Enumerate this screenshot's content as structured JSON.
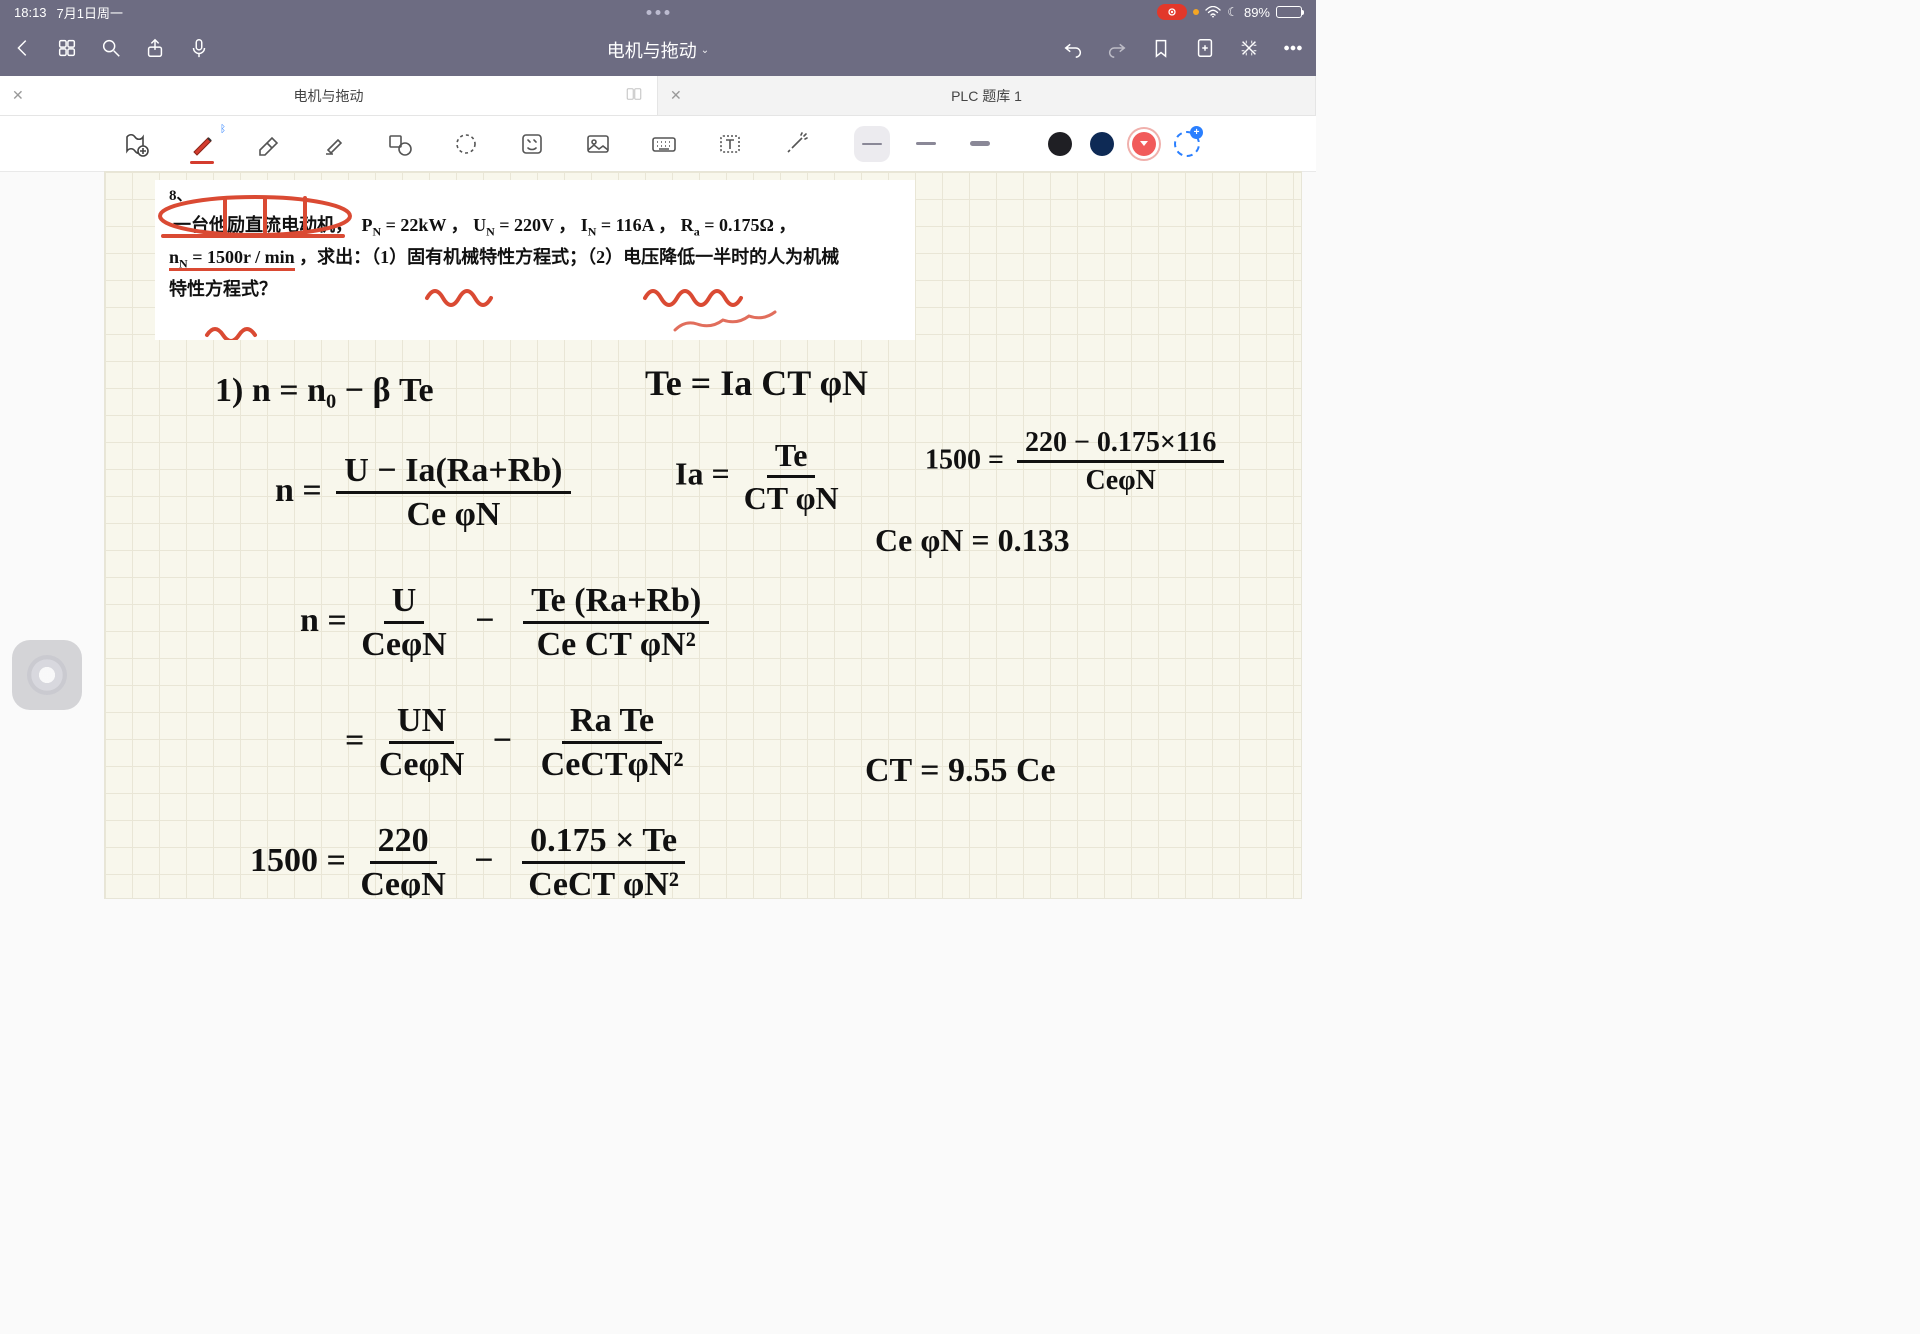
{
  "status": {
    "time": "18:13",
    "date": "7月1日周一",
    "battery_pct": "89%",
    "recording": true,
    "do_not_disturb": true
  },
  "appbar": {
    "title": "电机与拖动",
    "back_label": "返回",
    "undo_label": "撤销",
    "redo_label": "重做",
    "bookmark_label": "书签",
    "add_page_label": "新建页面",
    "close_label": "关闭",
    "more_label": "更多"
  },
  "tabs": [
    {
      "label": "电机与拖动",
      "active": true
    },
    {
      "label": "PLC 题库 1",
      "active": false
    }
  ],
  "tools": {
    "insert_image": "插入图片",
    "pen": "笔",
    "eraser": "橡皮擦",
    "highlighter": "荧光笔",
    "shape": "形状",
    "lasso": "套索",
    "sticker": "贴纸",
    "photo": "图片",
    "keyboard": "键盘",
    "text": "文本",
    "laser": "激光笔",
    "stroke_widths": [
      "细",
      "中",
      "粗"
    ],
    "selected_width": 0,
    "colors": [
      "#1f1f24",
      "#0e2a55",
      "#f15b5b"
    ],
    "selected_color": 2
  },
  "problem": {
    "index": "8、",
    "lead": "一台他励直流电动机，",
    "params": "P<sub>N</sub> = 22kW ，  U<sub>N</sub> = 220V ，  I<sub>N</sub> = 116A ，  R<sub>a</sub> = 0.175Ω ，",
    "line2a": "n<sub>N</sub> = 1500r / min",
    "line2b": "，求出：（1）固有机械特性方程式；（2）电压降低一半时的人为机械",
    "line3": "特性方程式？"
  },
  "handwriting": {
    "l1a": "1)   n  =   n₀  −  β Te",
    "l1b": "Te =  Ia CT φN",
    "l2_lhs": "n  =",
    "l2_num": "U − Ia(Ra+Rb)",
    "l2_den": "Ce φN",
    "l2b_lhs": "Ia  =",
    "l2b_num": "Te",
    "l2b_den": "CT φN",
    "l2c_lhs": "1500 =",
    "l2c_num": "220 − 0.175×116",
    "l2c_den": "CeφN",
    "l2d": "Ce φN =  0.133",
    "l3_lhs": "n =",
    "l3a_num": "U",
    "l3a_den": "CeφN",
    "l3b_num": "Te (Ra+Rb)",
    "l3b_den": "Ce CT φN²",
    "l4_lhs": "  =",
    "l4a_num": "UN",
    "l4a_den": "CeφN",
    "l4b_num": "Ra Te",
    "l4b_den": "CeCTφN²",
    "l4c": "CT = 9.55 Ce",
    "l5_lhs": "1500 =",
    "l5a_num": "220",
    "l5a_den": "CeφN",
    "l5b_num": "0.175 × Te",
    "l5b_den": "CeCT φN²"
  }
}
